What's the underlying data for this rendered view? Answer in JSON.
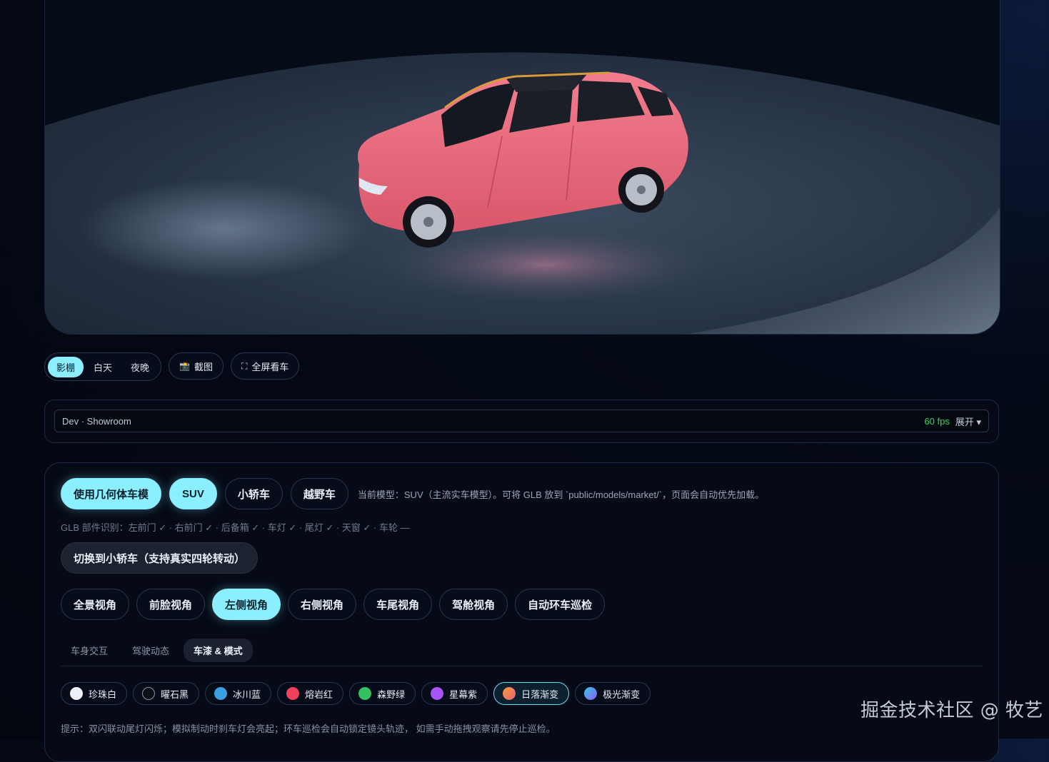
{
  "viewer": {
    "scene_alt": "pink-suv-3d-model"
  },
  "lighting_modes": [
    {
      "label": "影棚",
      "active": true
    },
    {
      "label": "白天",
      "active": false
    },
    {
      "label": "夜晚",
      "active": false
    }
  ],
  "actions": {
    "screenshot_label": "截图",
    "screenshot_icon": "📸",
    "fullscreen_label": "全屏看车",
    "fullscreen_icon": "⛶"
  },
  "dev": {
    "label": "Dev · Showroom",
    "fps": "60 fps",
    "expand": "展开 ▾"
  },
  "models": {
    "geometry_label": "使用几何体车模",
    "options": [
      {
        "label": "SUV",
        "active": true
      },
      {
        "label": "小轿车",
        "active": false
      },
      {
        "label": "越野车",
        "active": false
      }
    ],
    "note": "当前模型：SUV（主流实车模型）。可将 GLB 放到 `public/models/market/`，页面会自动优先加载。",
    "glb_status": "GLB 部件识别：左前门 ✓ · 右前门 ✓ · 后备箱 ✓ · 车灯 ✓ · 尾灯 ✓ · 天窗 ✓ · 车轮 —",
    "switch_label": "切换到小轿车（支持真实四轮转动）"
  },
  "views": [
    {
      "label": "全景视角",
      "active": false
    },
    {
      "label": "前脸视角",
      "active": false
    },
    {
      "label": "左侧视角",
      "active": true
    },
    {
      "label": "右侧视角",
      "active": false
    },
    {
      "label": "车尾视角",
      "active": false
    },
    {
      "label": "驾舱视角",
      "active": false
    },
    {
      "label": "自动环车巡检",
      "active": false
    }
  ],
  "tabs": [
    {
      "label": "车身交互",
      "active": false
    },
    {
      "label": "驾驶动态",
      "active": false
    },
    {
      "label": "车漆 & 模式",
      "active": true
    }
  ],
  "paints": [
    {
      "label": "珍珠白",
      "color": "#eef0f5",
      "active": false
    },
    {
      "label": "曜石黑",
      "color": "#0b0f18",
      "active": false
    },
    {
      "label": "冰川蓝",
      "color": "#3aa0e0",
      "active": false
    },
    {
      "label": "熔岩红",
      "color": "#f0405c",
      "active": false
    },
    {
      "label": "森野绿",
      "color": "#32c060",
      "active": false
    },
    {
      "label": "星幕紫",
      "color": "#a855f7",
      "active": false
    },
    {
      "label": "日落渐变",
      "color": "#f08a3a",
      "active": true
    },
    {
      "label": "极光渐变",
      "color": "#4f7ef0",
      "active": false
    }
  ],
  "hint": "提示：双闪联动尾灯闪烁；模拟制动时刹车灯会亮起；环车巡检会自动锁定镜头轨迹， 如需手动拖拽观察请先停止巡检。",
  "watermark": "掘金技术社区 @ 牧艺",
  "colors": {
    "accent": "#8cefff",
    "fps": "#3fd068",
    "car_paint": "#e8677a"
  }
}
